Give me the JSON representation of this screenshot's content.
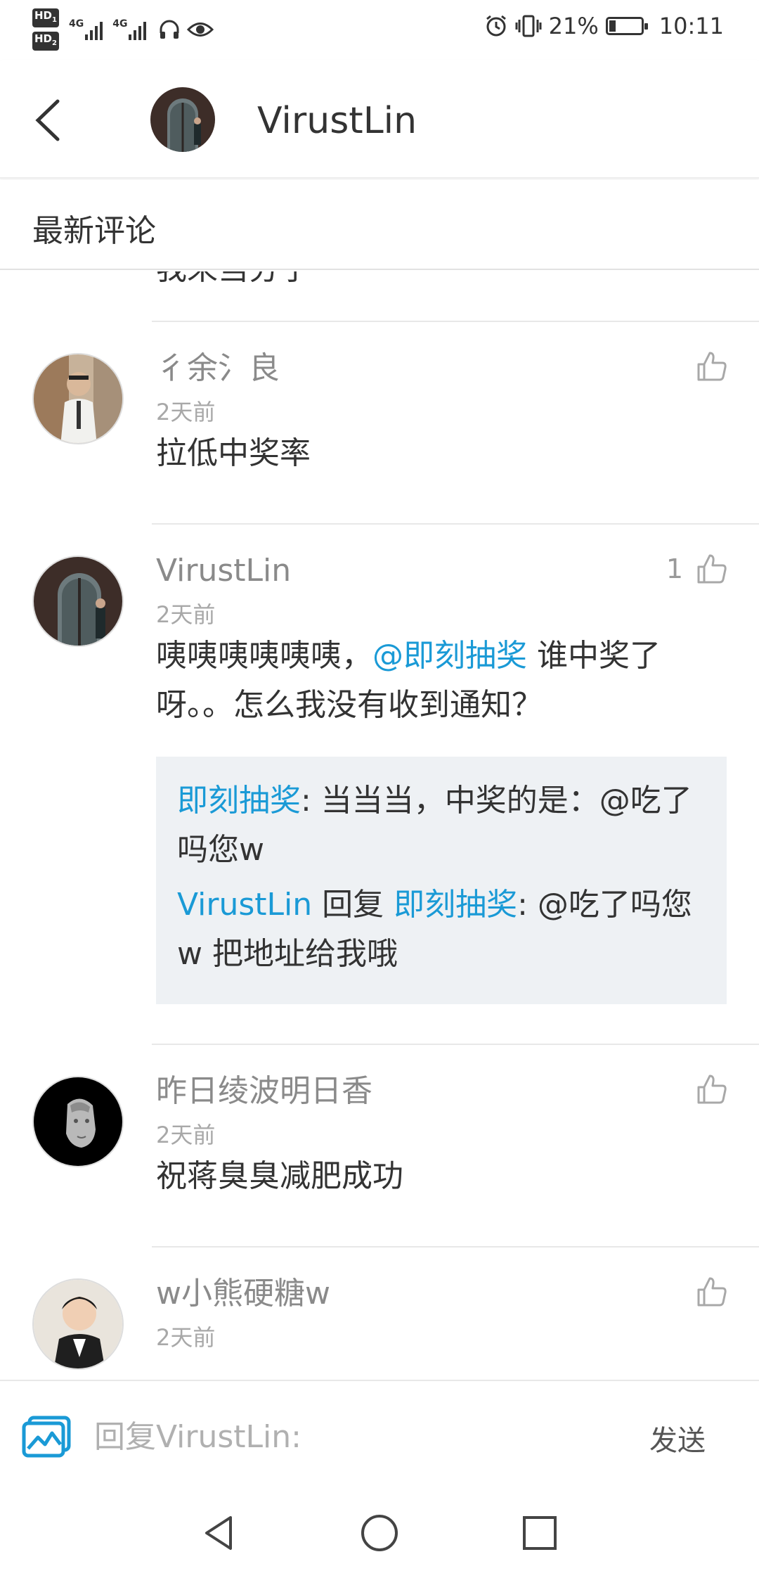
{
  "status_bar": {
    "hd1": "HD",
    "hd2": "HD",
    "net1": "4G",
    "net2": "4G",
    "battery_percent": "21%",
    "battery_level": 0.21,
    "time": "10:11",
    "icons": [
      "signal-icon",
      "headphones-icon",
      "eye-icon",
      "alarm-icon",
      "vibrate-icon",
      "battery-icon"
    ]
  },
  "header": {
    "title": "VirustLin",
    "back_icon": "chevron-left-icon"
  },
  "section": {
    "title": "最新评论"
  },
  "list": {
    "cut_text": "我来当分子",
    "comments": [
      {
        "username": "彳余氵良",
        "time": "2天前",
        "body": "拉低中奖率",
        "likes": ""
      },
      {
        "username": "VirustLin",
        "time": "2天前",
        "body_prefix": "咦咦咦咦咦咦，",
        "body_mention": "@即刻抽奖",
        "body_suffix": " 谁中奖了呀。。怎么我没有收到通知？",
        "likes": "1",
        "replies": [
          {
            "author": "即刻抽奖",
            "text": ": 当当当，中奖的是：@吃了吗您w"
          },
          {
            "author": "VirustLin",
            "connector": " 回复 ",
            "target": "即刻抽奖",
            "text": ": @吃了吗您w  把地址给我哦"
          }
        ]
      },
      {
        "username": "昨日绫波明日香",
        "time": "2天前",
        "body": "祝蒋臭臭减肥成功",
        "likes": ""
      },
      {
        "username": "w小熊硬糖w",
        "time": "2天前",
        "likes": ""
      }
    ]
  },
  "input_bar": {
    "placeholder": "回复VirustLin:",
    "send_label": "发送",
    "image_icon": "image-icon"
  },
  "nav_bar": {
    "icons": [
      "back-triangle-icon",
      "home-circle-icon",
      "recents-square-icon"
    ]
  },
  "colors": {
    "accent": "#1a9ad6",
    "reply_bg": "#eef1f4",
    "text": "#333333",
    "muted": "#8a8a8a"
  }
}
